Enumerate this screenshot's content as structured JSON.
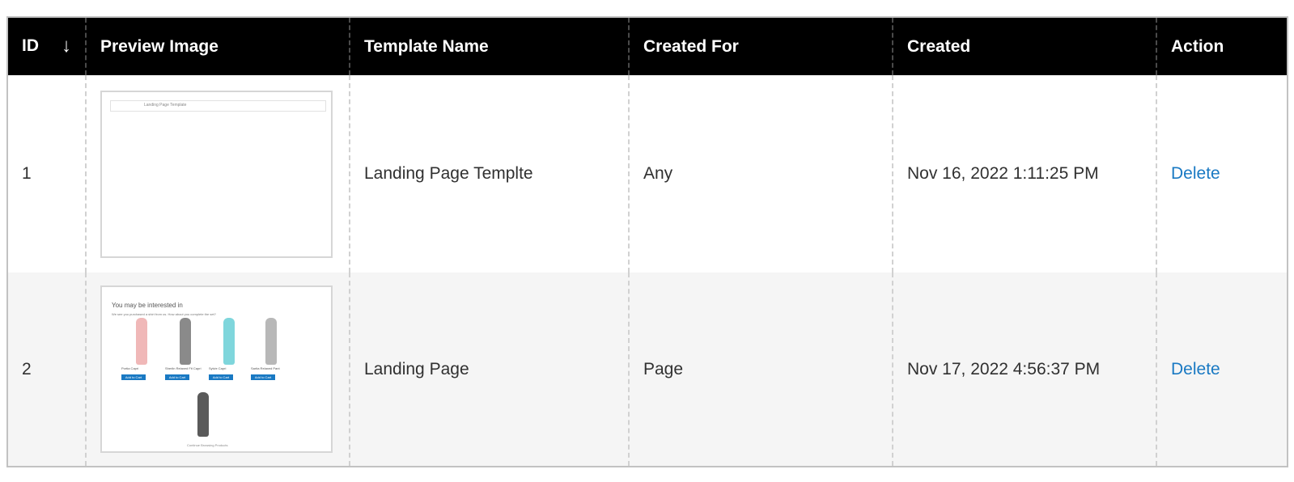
{
  "columns": {
    "id": "ID",
    "sort_arrow": "↓",
    "preview": "Preview Image",
    "template_name": "Template Name",
    "created_for": "Created For",
    "created": "Created",
    "action": "Action"
  },
  "rows": [
    {
      "id": "1",
      "template_name": "Landing Page Templte",
      "created_for": "Any",
      "created": "Nov 16, 2022 1:11:25 PM",
      "action": "Delete",
      "preview": {
        "bar_label": "Landing Page Template"
      }
    },
    {
      "id": "2",
      "template_name": "Landing Page",
      "created_for": "Page",
      "created": "Nov 17, 2022 4:56:37 PM",
      "action": "Delete",
      "preview": {
        "heading": "You may be interested in",
        "subtext": "We see you purchased a shirt from us. How about you complete the set?",
        "products": [
          {
            "name": "Portia Capri",
            "button": "Add to Cart",
            "color": "#f0b8b8"
          },
          {
            "name": "Sherlin Relaxed Fit Capri",
            "button": "Add to Cart",
            "color": "#8a8a8a"
          },
          {
            "name": "Sylvie Capri",
            "button": "Add to Cart",
            "color": "#7fd6dc"
          },
          {
            "name": "Sarita Relaxed Pant",
            "button": "Add to Cart",
            "color": "#b8b8b8"
          },
          {
            "name": "",
            "button": "",
            "color": "#5a5a5a"
          }
        ],
        "footer": "Continue Browsing Products"
      }
    }
  ]
}
